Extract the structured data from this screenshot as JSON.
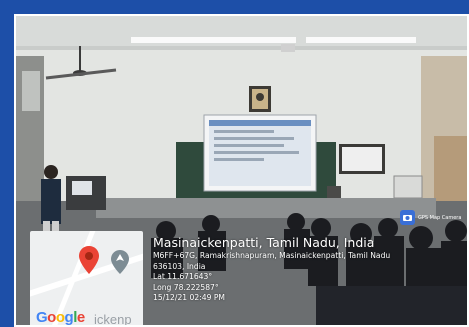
{
  "location": {
    "place": "Masinaickenpatti, Tamil Nadu, India",
    "address_line1": "M6FF+67G, Ramakrishnapuram, Masinaickenpatti, Tamil Nadu",
    "address_line2": "636103, India",
    "latitude": "Lat 11.671643°",
    "longitude": "Long 78.222587°",
    "timestamp": "15/12/21 02:49 PM"
  },
  "map": {
    "brand": "Google",
    "ghost_text": "ickenp"
  },
  "badge": {
    "label": "GPS Map Camera"
  },
  "colors": {
    "frame": "#1d4fa8",
    "wall": "#e4e6e3",
    "board": "#2f4a3c",
    "pin": "#ea4335"
  }
}
